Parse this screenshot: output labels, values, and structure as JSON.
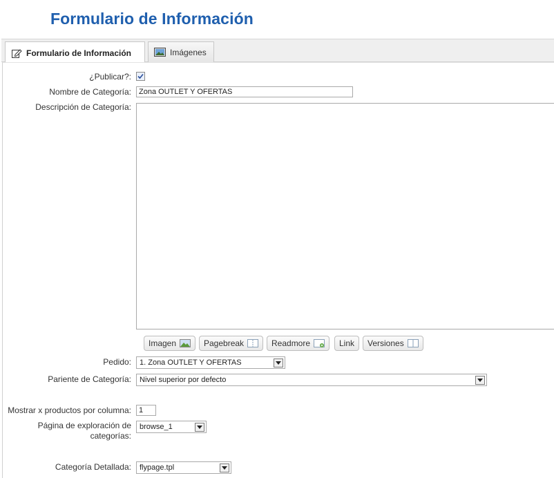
{
  "page": {
    "title": "Formulario de Información"
  },
  "tabs": [
    {
      "label": "Formulario de Información",
      "icon": "edit-form-icon",
      "active": true
    },
    {
      "label": "Imágenes",
      "icon": "image-icon",
      "active": false
    }
  ],
  "form": {
    "publish": {
      "label": "¿Publicar?:",
      "checked": true
    },
    "category_name": {
      "label": "Nombre de Categoría:",
      "value": "Zona OUTLET Y OFERTAS"
    },
    "category_description": {
      "label": "Descripción de Categoría:",
      "value": ""
    },
    "editor_buttons": [
      {
        "label": "Imagen",
        "icon": "image-icon"
      },
      {
        "label": "Pagebreak",
        "icon": "pagebreak-icon"
      },
      {
        "label": "Readmore",
        "icon": "readmore-icon"
      },
      {
        "label": "Link",
        "icon": ""
      },
      {
        "label": "Versiones",
        "icon": "versions-icon"
      }
    ],
    "order": {
      "label": "Pedido:",
      "value": "1. Zona OUTLET Y OFERTAS"
    },
    "parent_category": {
      "label": "Pariente de Categoría:",
      "value": "Nivel superior por defecto"
    },
    "products_per_row": {
      "label": "Mostrar x productos por columna:",
      "value": "1"
    },
    "browse_page": {
      "label_line1": "Página de exploración de",
      "label_line2": "categorías:",
      "value": "browse_1"
    },
    "detail_page": {
      "label": "Categoría Detallada:",
      "value": "flypage.tpl"
    }
  },
  "colors": {
    "title": "#1f5fae",
    "checkbox_check": "#2a4f9b"
  }
}
